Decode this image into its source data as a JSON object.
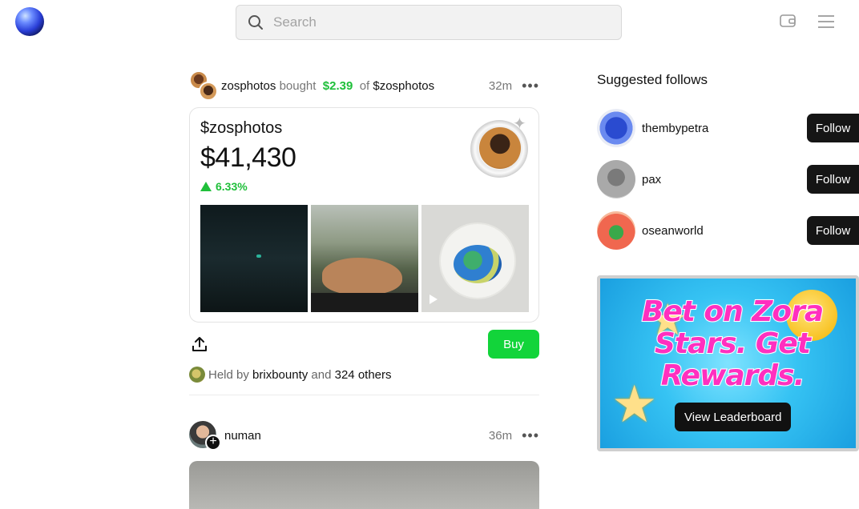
{
  "header": {
    "search_placeholder": "Search"
  },
  "post1": {
    "user": "zosphotos",
    "action": "bought",
    "amount": "$2.39",
    "of_label": "of",
    "coin": "$zosphotos",
    "time": "32m",
    "card": {
      "coin_name": "$zosphotos",
      "price": "$41,430",
      "change": "6.33%"
    },
    "buy_label": "Buy",
    "held_prefix": "Held by",
    "held_by": "brixbounty",
    "held_and": "and",
    "held_others": "324 others"
  },
  "post2": {
    "user": "numan",
    "time": "36m"
  },
  "sidebar": {
    "title": "Suggested follows",
    "follow_label": "Follow",
    "suggestions": [
      {
        "name": "thembypetra"
      },
      {
        "name": "pax"
      },
      {
        "name": "oseanworld"
      }
    ],
    "promo": {
      "headline": "Bet on Zora Stars. Get Rewards.",
      "button": "View Leaderboard"
    }
  },
  "colors": {
    "accent_green": "#12d43a",
    "follow_bg": "#151515"
  }
}
